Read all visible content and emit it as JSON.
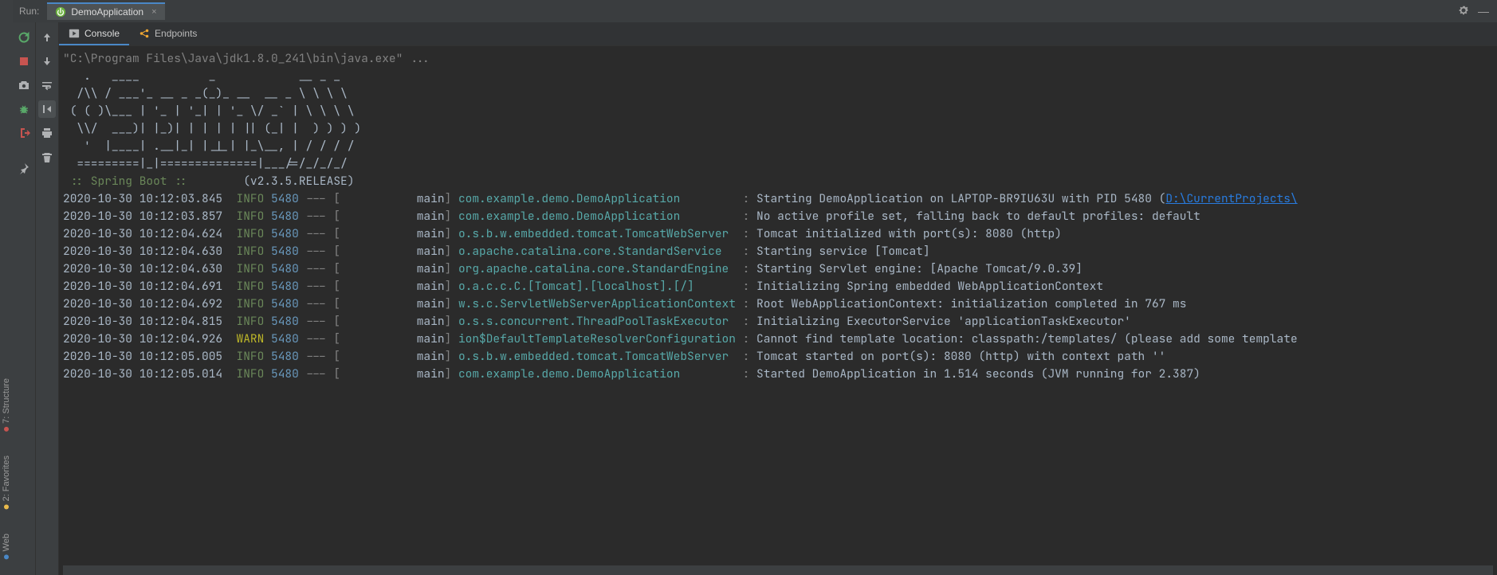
{
  "header": {
    "run_label": "Run:",
    "run_config_name": "DemoApplication",
    "close_tooltip": "×"
  },
  "content_tabs": {
    "console": "Console",
    "endpoints": "Endpoints"
  },
  "left_rail": {
    "structure": "7: Structure",
    "favorites": "2: Favorites",
    "web": "Web"
  },
  "console": {
    "cmd": "\"C:\\Program Files\\Java\\jdk1.8.0_241\\bin\\java.exe\" ...",
    "banner": [
      "   .   ____          _            __ _ _",
      "  /\\\\ / ___'_ __ _ _(_)_ __  __ _ \\ \\ \\ \\",
      " ( ( )\\___ | '_ | '_| | '_ \\/ _` | \\ \\ \\ \\",
      "  \\\\/  ___)| |_)| | | | | || (_| |  ) ) ) )",
      "   '  |____| .__|_| |_|_| |_\\__, | / / / /",
      "  =========|_|==============|___/=/_/_/_/"
    ],
    "boot_label": " :: Spring Boot ::",
    "boot_version": "(v2.3.5.RELEASE)",
    "link_text": "D:\\CurrentProjects\\",
    "lines": [
      {
        "ts": "2020-10-30 10:12:03.845",
        "lvl": "INFO",
        "pid": "5480",
        "thread": "main",
        "logger": "com.example.demo.DemoApplication",
        "msg_pre": "Starting DemoApplication on LAPTOP-BR9IU63U with PID 5480 (",
        "msg_post": "",
        "link": true
      },
      {
        "ts": "2020-10-30 10:12:03.857",
        "lvl": "INFO",
        "pid": "5480",
        "thread": "main",
        "logger": "com.example.demo.DemoApplication",
        "msg": "No active profile set, falling back to default profiles: default"
      },
      {
        "ts": "2020-10-30 10:12:04.624",
        "lvl": "INFO",
        "pid": "5480",
        "thread": "main",
        "logger": "o.s.b.w.embedded.tomcat.TomcatWebServer",
        "msg": "Tomcat initialized with port(s): 8080 (http)"
      },
      {
        "ts": "2020-10-30 10:12:04.630",
        "lvl": "INFO",
        "pid": "5480",
        "thread": "main",
        "logger": "o.apache.catalina.core.StandardService",
        "msg": "Starting service [Tomcat]"
      },
      {
        "ts": "2020-10-30 10:12:04.630",
        "lvl": "INFO",
        "pid": "5480",
        "thread": "main",
        "logger": "org.apache.catalina.core.StandardEngine",
        "msg": "Starting Servlet engine: [Apache Tomcat/9.0.39]"
      },
      {
        "ts": "2020-10-30 10:12:04.691",
        "lvl": "INFO",
        "pid": "5480",
        "thread": "main",
        "logger": "o.a.c.c.C.[Tomcat].[localhost].[/]",
        "msg": "Initializing Spring embedded WebApplicationContext"
      },
      {
        "ts": "2020-10-30 10:12:04.692",
        "lvl": "INFO",
        "pid": "5480",
        "thread": "main",
        "logger": "w.s.c.ServletWebServerApplicationContext",
        "msg": "Root WebApplicationContext: initialization completed in 767 ms"
      },
      {
        "ts": "2020-10-30 10:12:04.815",
        "lvl": "INFO",
        "pid": "5480",
        "thread": "main",
        "logger": "o.s.s.concurrent.ThreadPoolTaskExecutor",
        "msg": "Initializing ExecutorService 'applicationTaskExecutor'"
      },
      {
        "ts": "2020-10-30 10:12:04.926",
        "lvl": "WARN",
        "pid": "5480",
        "thread": "main",
        "logger": "ion$DefaultTemplateResolverConfiguration",
        "msg": "Cannot find template location: classpath:/templates/ (please add some template"
      },
      {
        "ts": "2020-10-30 10:12:05.005",
        "lvl": "INFO",
        "pid": "5480",
        "thread": "main",
        "logger": "o.s.b.w.embedded.tomcat.TomcatWebServer",
        "msg": "Tomcat started on port(s): 8080 (http) with context path ''"
      },
      {
        "ts": "2020-10-30 10:12:05.014",
        "lvl": "INFO",
        "pid": "5480",
        "thread": "main",
        "logger": "com.example.demo.DemoApplication",
        "msg": "Started DemoApplication in 1.514 seconds (JVM running for 2.387)"
      }
    ]
  }
}
